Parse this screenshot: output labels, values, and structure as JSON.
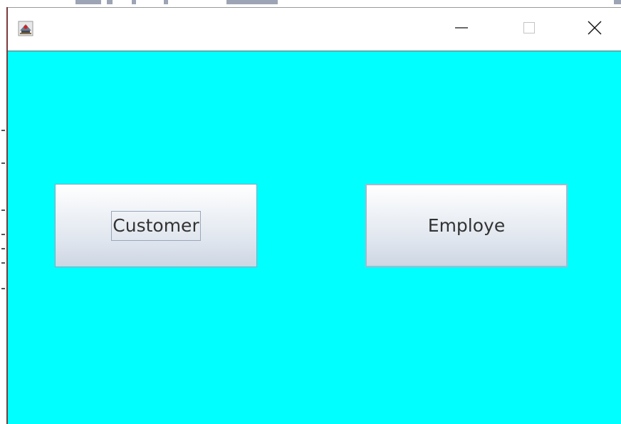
{
  "window": {
    "title": "",
    "controls": {
      "minimize_icon": "minimize-icon",
      "maximize_icon": "maximize-icon",
      "close_icon": "close-icon"
    },
    "app_icon": "java-app-icon"
  },
  "content": {
    "background": "#00ffff",
    "buttons": {
      "customer_label": "Customer",
      "employe_label": "Employe"
    }
  }
}
